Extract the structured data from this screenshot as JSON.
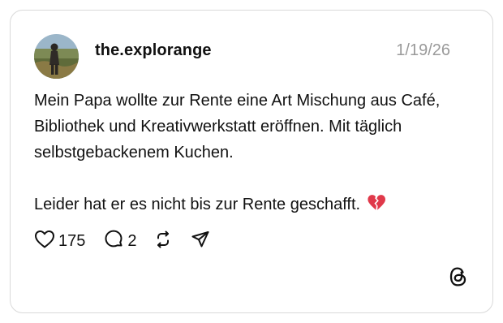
{
  "post": {
    "username": "the.explorange",
    "date": "1/19/26",
    "paragraphs": [
      "Mein Papa wollte zur Rente eine Art Mischung aus Café, Bibliothek und Kreativwerkstatt eröffnen. Mit täglich selbstgebackenem Kuchen.",
      "Leider hat er es nicht bis zur Rente geschafft."
    ],
    "emoji": "broken-heart-icon"
  },
  "actions": {
    "likes": "175",
    "replies": "2"
  },
  "icons": [
    "heart-icon",
    "reply-icon",
    "repost-icon",
    "share-icon",
    "threads-logo-icon"
  ],
  "colors": {
    "text": "#111111",
    "muted": "#9a9a9a",
    "border": "#d9d9d9",
    "broken_heart": "#e0394a"
  }
}
